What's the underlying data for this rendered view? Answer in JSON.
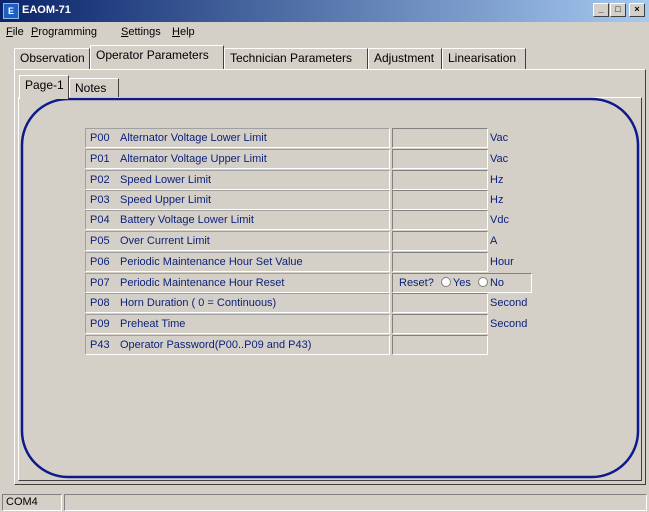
{
  "window": {
    "title": "EAOM-71",
    "icon": "app-logo-icon",
    "controls": [
      "minimize-icon",
      "maximize-icon",
      "close-icon"
    ]
  },
  "menu": {
    "items": [
      {
        "label": "File",
        "mnemonic": "F",
        "rest": "ile"
      },
      {
        "label": "Programming",
        "mnemonic": "P",
        "rest": "rogramming"
      },
      {
        "label": "Settings",
        "mnemonic": "S",
        "rest": "ettings"
      },
      {
        "label": "Help",
        "mnemonic": "H",
        "rest": "elp"
      }
    ]
  },
  "tabs": [
    {
      "label": "Observation",
      "active": false
    },
    {
      "label": "Operator Parameters",
      "active": true
    },
    {
      "label": "Technician Parameters",
      "active": false
    },
    {
      "label": "Adjustment",
      "active": false
    },
    {
      "label": "Linearisation",
      "active": false
    }
  ],
  "subtabs": [
    {
      "label": "Page-1",
      "active": true
    },
    {
      "label": "Notes",
      "active": false
    }
  ],
  "parameters": [
    {
      "code": "P00",
      "name": "Alternator Voltage Lower Limit",
      "value": "",
      "unit": "Vac"
    },
    {
      "code": "P01",
      "name": "Alternator Voltage Upper Limit",
      "value": "",
      "unit": "Vac"
    },
    {
      "code": "P02",
      "name": "Speed Lower Limit",
      "value": "",
      "unit": "Hz"
    },
    {
      "code": "P03",
      "name": "Speed Upper Limit",
      "value": "",
      "unit": "Hz"
    },
    {
      "code": "P04",
      "name": "Battery Voltage Lower Limit",
      "value": "",
      "unit": "Vdc"
    },
    {
      "code": "P05",
      "name": "Over Current Limit",
      "value": "",
      "unit": "A"
    },
    {
      "code": "P06",
      "name": "Periodic Maintenance Hour Set Value",
      "value": "",
      "unit": "Hour"
    },
    {
      "code": "P07",
      "name": "Periodic Maintenance Hour Reset",
      "value": "",
      "unit": ""
    },
    {
      "code": "P08",
      "name": "Horn Duration ( 0 = Continuous)",
      "value": "",
      "unit": "Second"
    },
    {
      "code": "P09",
      "name": "Preheat Time",
      "value": "",
      "unit": "Second"
    },
    {
      "code": "P43",
      "name": "Operator Password(P00..P09 and P43)",
      "value": "",
      "unit": ""
    }
  ],
  "reset": {
    "label": "Reset?",
    "options": [
      "Yes",
      "No"
    ],
    "selected": ""
  },
  "status": {
    "port": "COM4",
    "message": ""
  },
  "colors": {
    "frame": "#0c1a8c",
    "label_text": "#0a1f7a",
    "title_gradient_start": "#0a246a",
    "title_gradient_end": "#a6caf0"
  }
}
